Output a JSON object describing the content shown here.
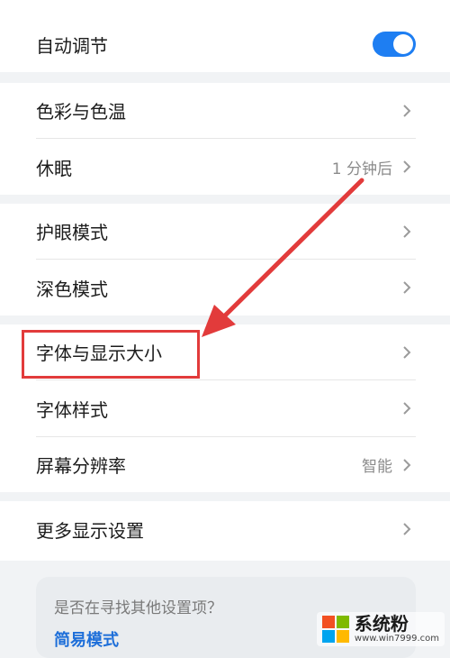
{
  "card1": {
    "auto_adjust_label": "自动调节",
    "auto_adjust_on": true
  },
  "card2": {
    "color_temp_label": "色彩与色温",
    "sleep_label": "休眠",
    "sleep_value": "1 分钟后"
  },
  "card3": {
    "eye_care_label": "护眼模式",
    "dark_mode_label": "深色模式"
  },
  "card4": {
    "font_display_size_label": "字体与显示大小",
    "font_style_label": "字体样式",
    "resolution_label": "屏幕分辨率",
    "resolution_value": "智能"
  },
  "card5": {
    "more_display_label": "更多显示设置"
  },
  "hint": {
    "question": "是否在寻找其他设置项？",
    "link": "简易模式"
  },
  "watermark": {
    "brand": "系统粉",
    "url": "www.win7999.com"
  },
  "colors": {
    "accent": "#1e7ef2",
    "annotation_red": "#e23b3b",
    "link_blue": "#1e6fd9",
    "logo": [
      "#f25022",
      "#7fba00",
      "#00a4ef",
      "#ffb900"
    ]
  },
  "icons": [
    "chevron-right-icon",
    "toggle-switch",
    "annotation-arrow",
    "windows-logo-icon"
  ]
}
